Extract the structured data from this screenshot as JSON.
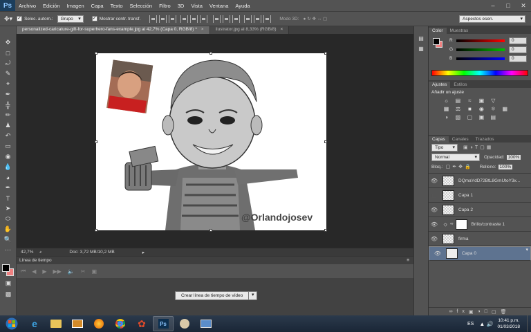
{
  "app": {
    "logo": "Ps"
  },
  "menu": [
    "Archivo",
    "Edición",
    "Imagen",
    "Capa",
    "Texto",
    "Selección",
    "Filtro",
    "3D",
    "Vista",
    "Ventana",
    "Ayuda"
  ],
  "options": {
    "auto_select_label": "Selec. autom.:",
    "auto_select_value": "Grupo",
    "show_transform_label": "Mostrar contr. transf.",
    "mode3d_label": "Modo 3D:",
    "workspace": "Aspectos esen."
  },
  "tabs": [
    {
      "label": "personalized-caricature-gift-for-superhero-fans-example.jpg al 42,7% (Capa 0, RGB/8) *",
      "active": true
    },
    {
      "label": "ilustrator.jpg al 8,33% (RGB/8)",
      "active": false
    }
  ],
  "document": {
    "watermark": "@Orlandojosev"
  },
  "status": {
    "zoom": "42,7%",
    "doc_info": "Doc: 3,72 MB/10,2 MB"
  },
  "timeline": {
    "title": "Línea de tiempo",
    "create_button": "Crear línea de tiempo de vídeo"
  },
  "color_panel": {
    "tabs": [
      "Color",
      "Muestras"
    ],
    "channels": [
      {
        "label": "R",
        "value": "0",
        "gradient": "#ff0000"
      },
      {
        "label": "G",
        "value": "0",
        "gradient": "#00c000"
      },
      {
        "label": "B",
        "value": "0",
        "gradient": "#0000ff"
      }
    ]
  },
  "adjust_panel": {
    "tabs": [
      "Ajustes",
      "Estilos"
    ],
    "heading": "Añadir un ajuste"
  },
  "layers_panel": {
    "tabs": [
      "Capas",
      "Canales",
      "Trazados"
    ],
    "filter": "Tipo",
    "blend_mode": "Normal",
    "opacity_label": "Opacidad:",
    "opacity": "100%",
    "lock_label": "Bloq.:",
    "fill_label": "Relleno:",
    "fill": "100%",
    "layers": [
      {
        "name": "DQmaYdD72BtL8GmUtoY3x...",
        "visible": true,
        "selected": false
      },
      {
        "name": "Capa 1",
        "visible": false,
        "selected": false
      },
      {
        "name": "Capa 2",
        "visible": true,
        "selected": false
      },
      {
        "name": "Brillo/contraste 1",
        "visible": true,
        "selected": false
      },
      {
        "name": "firma",
        "visible": true,
        "selected": false
      },
      {
        "name": "Capa 0",
        "visible": true,
        "selected": true
      }
    ]
  },
  "taskbar": {
    "lang": "ES",
    "time": "10:41 p.m.",
    "date": "01/03/2018"
  }
}
